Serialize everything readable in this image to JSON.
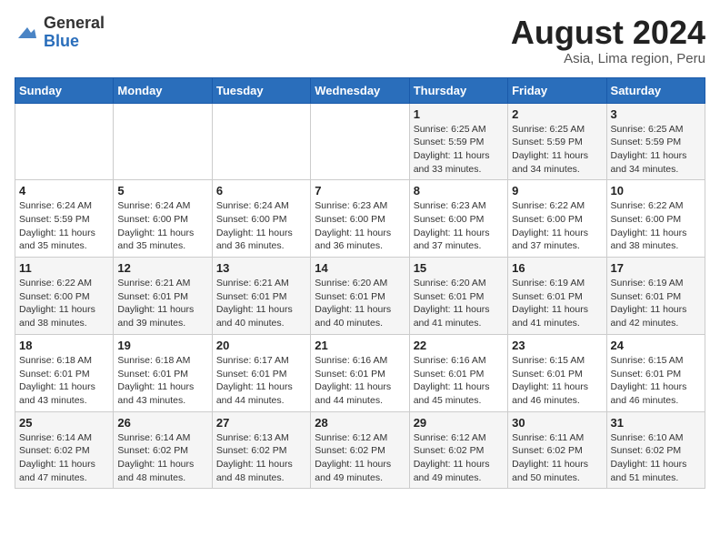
{
  "header": {
    "logo_general": "General",
    "logo_blue": "Blue",
    "month_year": "August 2024",
    "region": "Asia, Lima region, Peru"
  },
  "weekdays": [
    "Sunday",
    "Monday",
    "Tuesday",
    "Wednesday",
    "Thursday",
    "Friday",
    "Saturday"
  ],
  "weeks": [
    [
      {
        "day": "",
        "info": ""
      },
      {
        "day": "",
        "info": ""
      },
      {
        "day": "",
        "info": ""
      },
      {
        "day": "",
        "info": ""
      },
      {
        "day": "1",
        "info": "Sunrise: 6:25 AM\nSunset: 5:59 PM\nDaylight: 11 hours\nand 33 minutes."
      },
      {
        "day": "2",
        "info": "Sunrise: 6:25 AM\nSunset: 5:59 PM\nDaylight: 11 hours\nand 34 minutes."
      },
      {
        "day": "3",
        "info": "Sunrise: 6:25 AM\nSunset: 5:59 PM\nDaylight: 11 hours\nand 34 minutes."
      }
    ],
    [
      {
        "day": "4",
        "info": "Sunrise: 6:24 AM\nSunset: 5:59 PM\nDaylight: 11 hours\nand 35 minutes."
      },
      {
        "day": "5",
        "info": "Sunrise: 6:24 AM\nSunset: 6:00 PM\nDaylight: 11 hours\nand 35 minutes."
      },
      {
        "day": "6",
        "info": "Sunrise: 6:24 AM\nSunset: 6:00 PM\nDaylight: 11 hours\nand 36 minutes."
      },
      {
        "day": "7",
        "info": "Sunrise: 6:23 AM\nSunset: 6:00 PM\nDaylight: 11 hours\nand 36 minutes."
      },
      {
        "day": "8",
        "info": "Sunrise: 6:23 AM\nSunset: 6:00 PM\nDaylight: 11 hours\nand 37 minutes."
      },
      {
        "day": "9",
        "info": "Sunrise: 6:22 AM\nSunset: 6:00 PM\nDaylight: 11 hours\nand 37 minutes."
      },
      {
        "day": "10",
        "info": "Sunrise: 6:22 AM\nSunset: 6:00 PM\nDaylight: 11 hours\nand 38 minutes."
      }
    ],
    [
      {
        "day": "11",
        "info": "Sunrise: 6:22 AM\nSunset: 6:00 PM\nDaylight: 11 hours\nand 38 minutes."
      },
      {
        "day": "12",
        "info": "Sunrise: 6:21 AM\nSunset: 6:01 PM\nDaylight: 11 hours\nand 39 minutes."
      },
      {
        "day": "13",
        "info": "Sunrise: 6:21 AM\nSunset: 6:01 PM\nDaylight: 11 hours\nand 40 minutes."
      },
      {
        "day": "14",
        "info": "Sunrise: 6:20 AM\nSunset: 6:01 PM\nDaylight: 11 hours\nand 40 minutes."
      },
      {
        "day": "15",
        "info": "Sunrise: 6:20 AM\nSunset: 6:01 PM\nDaylight: 11 hours\nand 41 minutes."
      },
      {
        "day": "16",
        "info": "Sunrise: 6:19 AM\nSunset: 6:01 PM\nDaylight: 11 hours\nand 41 minutes."
      },
      {
        "day": "17",
        "info": "Sunrise: 6:19 AM\nSunset: 6:01 PM\nDaylight: 11 hours\nand 42 minutes."
      }
    ],
    [
      {
        "day": "18",
        "info": "Sunrise: 6:18 AM\nSunset: 6:01 PM\nDaylight: 11 hours\nand 43 minutes."
      },
      {
        "day": "19",
        "info": "Sunrise: 6:18 AM\nSunset: 6:01 PM\nDaylight: 11 hours\nand 43 minutes."
      },
      {
        "day": "20",
        "info": "Sunrise: 6:17 AM\nSunset: 6:01 PM\nDaylight: 11 hours\nand 44 minutes."
      },
      {
        "day": "21",
        "info": "Sunrise: 6:16 AM\nSunset: 6:01 PM\nDaylight: 11 hours\nand 44 minutes."
      },
      {
        "day": "22",
        "info": "Sunrise: 6:16 AM\nSunset: 6:01 PM\nDaylight: 11 hours\nand 45 minutes."
      },
      {
        "day": "23",
        "info": "Sunrise: 6:15 AM\nSunset: 6:01 PM\nDaylight: 11 hours\nand 46 minutes."
      },
      {
        "day": "24",
        "info": "Sunrise: 6:15 AM\nSunset: 6:01 PM\nDaylight: 11 hours\nand 46 minutes."
      }
    ],
    [
      {
        "day": "25",
        "info": "Sunrise: 6:14 AM\nSunset: 6:02 PM\nDaylight: 11 hours\nand 47 minutes."
      },
      {
        "day": "26",
        "info": "Sunrise: 6:14 AM\nSunset: 6:02 PM\nDaylight: 11 hours\nand 48 minutes."
      },
      {
        "day": "27",
        "info": "Sunrise: 6:13 AM\nSunset: 6:02 PM\nDaylight: 11 hours\nand 48 minutes."
      },
      {
        "day": "28",
        "info": "Sunrise: 6:12 AM\nSunset: 6:02 PM\nDaylight: 11 hours\nand 49 minutes."
      },
      {
        "day": "29",
        "info": "Sunrise: 6:12 AM\nSunset: 6:02 PM\nDaylight: 11 hours\nand 49 minutes."
      },
      {
        "day": "30",
        "info": "Sunrise: 6:11 AM\nSunset: 6:02 PM\nDaylight: 11 hours\nand 50 minutes."
      },
      {
        "day": "31",
        "info": "Sunrise: 6:10 AM\nSunset: 6:02 PM\nDaylight: 11 hours\nand 51 minutes."
      }
    ]
  ]
}
